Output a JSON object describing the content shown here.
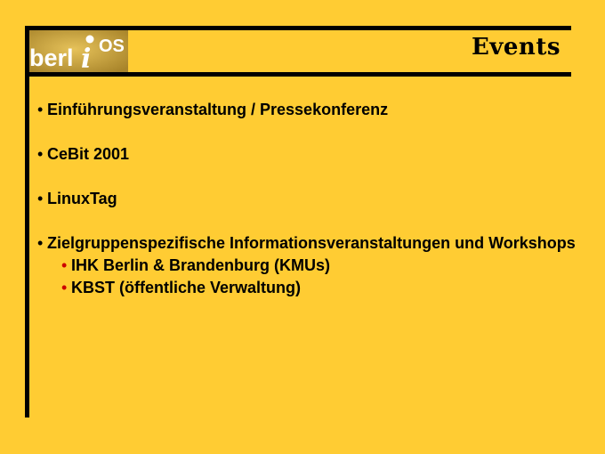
{
  "slide": {
    "title": "Events",
    "logo": {
      "text_main": "berl",
      "text_i": "i",
      "text_os": "OS",
      "background": "#c9a33a"
    },
    "bullets": [
      {
        "text": "Einführungsveranstaltung / Pressekonferenz"
      },
      {
        "text": "CeBit 2001"
      },
      {
        "text": "LinuxTag"
      },
      {
        "text": "Zielgruppenspezifische Informationsveranstaltungen und Workshops",
        "subitems": [
          {
            "text": "IHK Berlin & Brandenburg (KMUs)"
          },
          {
            "text": "KBST (öffentliche Verwaltung)"
          }
        ]
      }
    ],
    "colors": {
      "background": "#ffcc33",
      "frame": "#000000",
      "sub_bullet": "#cc0000"
    },
    "bullet_glyph": "•"
  }
}
